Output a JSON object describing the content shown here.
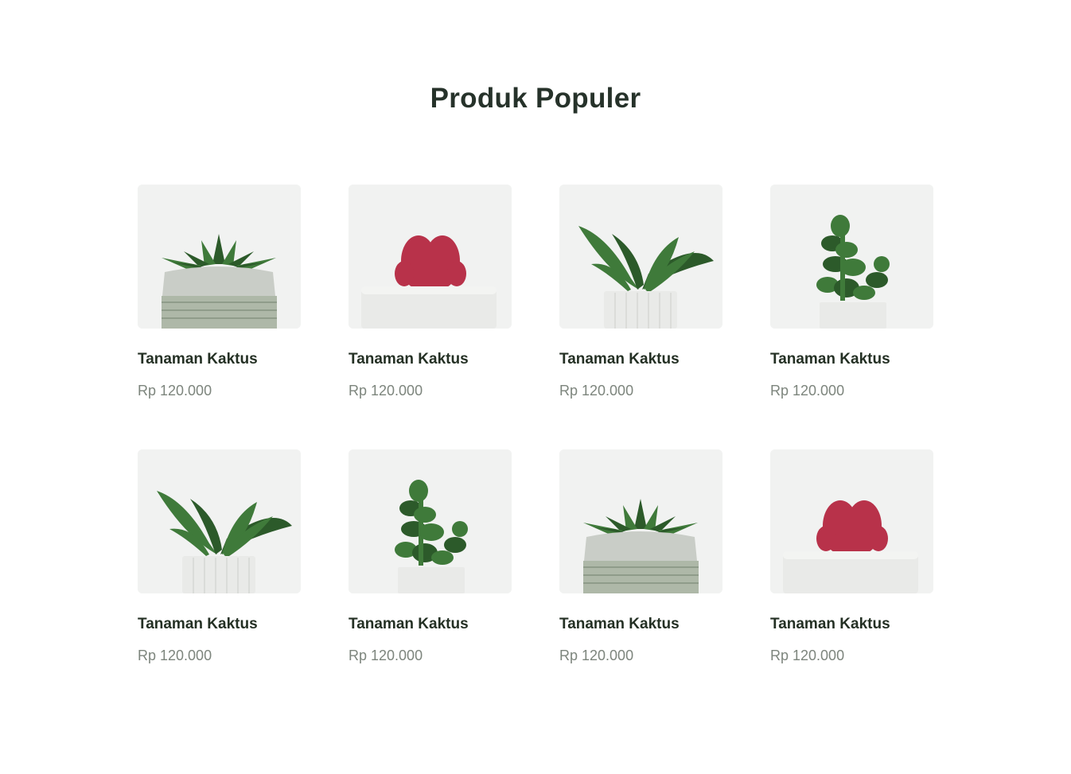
{
  "section": {
    "title": "Produk Populer"
  },
  "products": [
    {
      "name": "Tanaman Kaktus",
      "price": "Rp 120.000",
      "plant": "agave-round-pot-icon"
    },
    {
      "name": "Tanaman Kaktus",
      "price": "Rp 120.000",
      "plant": "red-cactus-pot-icon"
    },
    {
      "name": "Tanaman Kaktus",
      "price": "Rp 120.000",
      "plant": "leafy-succulent-pot-icon"
    },
    {
      "name": "Tanaman Kaktus",
      "price": "Rp 120.000",
      "plant": "tall-succulent-pot-icon"
    },
    {
      "name": "Tanaman Kaktus",
      "price": "Rp 120.000",
      "plant": "leafy-succulent-pot-icon"
    },
    {
      "name": "Tanaman Kaktus",
      "price": "Rp 120.000",
      "plant": "tall-succulent-pot-icon"
    },
    {
      "name": "Tanaman Kaktus",
      "price": "Rp 120.000",
      "plant": "agave-round-pot-icon"
    },
    {
      "name": "Tanaman Kaktus",
      "price": "Rp 120.000",
      "plant": "red-cactus-pot-icon"
    }
  ],
  "colors": {
    "heading": "#26322a",
    "price": "#7d857d",
    "thumb_bg": "#f1f2f1",
    "leaf": "#3f7a3a",
    "leaf_dark": "#2c5a2a",
    "cactus_red": "#b8324a",
    "pot_white": "#e9eae8",
    "pot_grey": "#c9cdc7"
  }
}
